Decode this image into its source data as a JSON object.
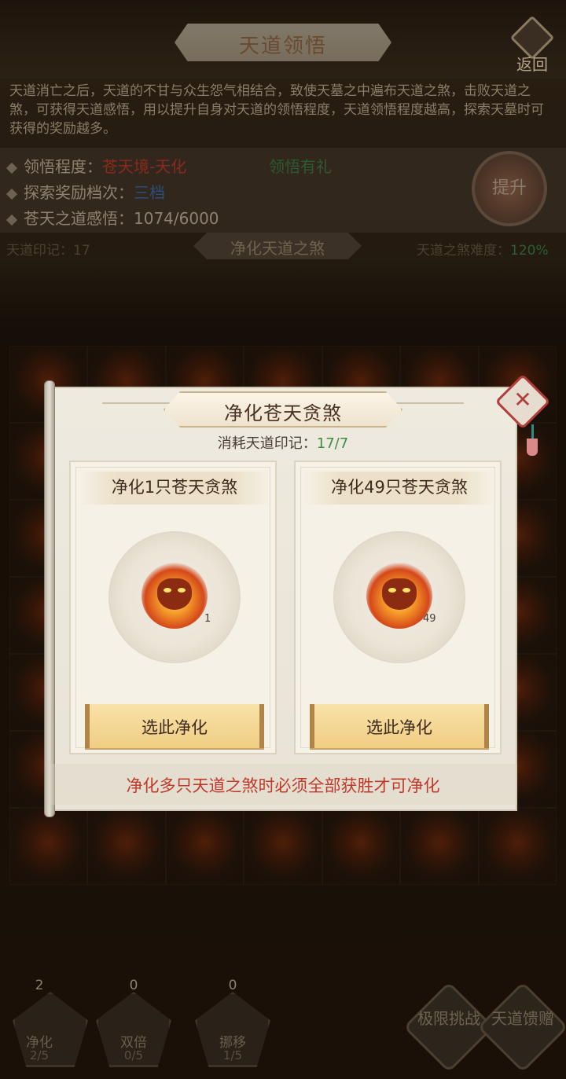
{
  "header": {
    "title": "天道领悟",
    "back_label": "返回"
  },
  "description": "天道消亡之后，天道的不甘与众生怨气相结合，致使天墓之中遍布天道之煞，击败天道之煞，可获得天道感悟，用以提升自身对天道的领悟程度，天道领悟程度越高，探索天墓时可获得的奖励越多。",
  "info": {
    "level_label": "领悟程度：",
    "level_value": "苍天境-天化",
    "reward_label": "探索奖励档次：",
    "reward_value": "三档",
    "insight_label": "苍天之道感悟：",
    "insight_value": "1074/6000",
    "gift_link": "领悟有礼",
    "upgrade_label": "提升"
  },
  "status": {
    "mark_count": "天道印记：17",
    "section_title": "净化天道之煞",
    "difficulty_label": "天道之煞难度：",
    "difficulty_value": "120%"
  },
  "skills": [
    {
      "label": "净化",
      "count": "2",
      "uses": "2/5"
    },
    {
      "label": "双倍",
      "count": "0",
      "uses": "0/5"
    },
    {
      "label": "挪移",
      "count": "0",
      "uses": "1/5"
    }
  ],
  "side_buttons": {
    "challenge": "极限挑战",
    "gift": "天道馈赠"
  },
  "modal": {
    "title": "净化苍天贪煞",
    "cost_label": "消耗天道印记：",
    "cost_value": "17/7",
    "options": [
      {
        "title": "净化1只苍天贪煞",
        "qty": "1",
        "button": "选此净化"
      },
      {
        "title": "净化49只苍天贪煞",
        "qty": "49",
        "button": "选此净化"
      }
    ],
    "footer_note": "净化多只天道之煞时必须全部获胜才可净化"
  },
  "colors": {
    "accent_red": "#c0392b",
    "accent_green": "#3b8e3f",
    "button_gold": "#f0cd83"
  }
}
